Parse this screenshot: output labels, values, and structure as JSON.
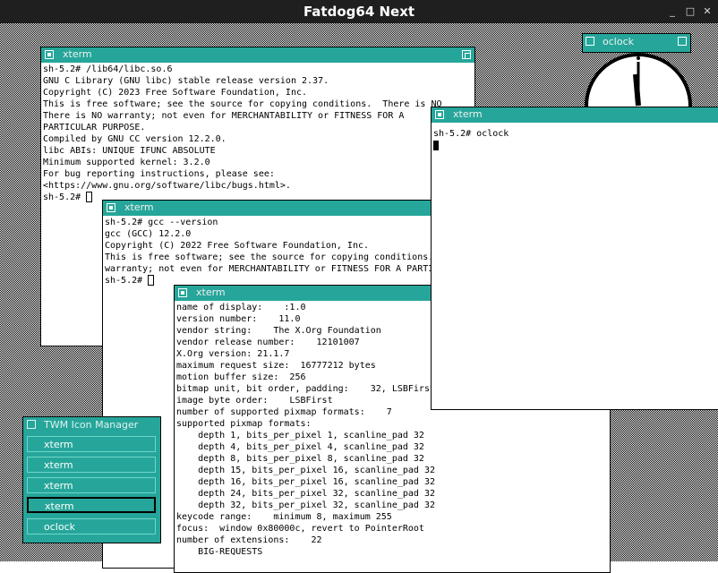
{
  "screen": {
    "title": "Fatdog64 Next",
    "btn_min": "_",
    "btn_max": "□",
    "btn_close": "✕"
  },
  "win1": {
    "title": "xterm",
    "lines": [
      "sh-5.2# /lib64/libc.so.6",
      "GNU C Library (GNU libc) stable release version 2.37.",
      "Copyright (C) 2023 Free Software Foundation, Inc.",
      "This is free software; see the source for copying conditions.  There is NO",
      "There is NO warranty; not even for MERCHANTABILITY or FITNESS FOR A",
      "PARTICULAR PURPOSE.",
      "Compiled by GNU CC version 12.2.0.",
      "libc ABIs: UNIQUE IFUNC ABSOLUTE",
      "Minimum supported kernel: 3.2.0",
      "For bug reporting instructions, please see:",
      "<https://www.gnu.org/software/libc/bugs.html>.",
      "sh-5.2# "
    ]
  },
  "win2": {
    "title": "xterm",
    "lines": [
      "sh-5.2# gcc --version",
      "gcc (GCC) 12.2.0",
      "Copyright (C) 2022 Free Software Foundation, Inc.",
      "This is free software; see the source for copying conditions.",
      "warranty; not even for MERCHANTABILITY or FITNESS FOR A PARTI",
      "",
      "sh-5.2# "
    ]
  },
  "win3": {
    "title": "xterm",
    "lines": [
      "name of display:    :1.0",
      "version number:    11.0",
      "vendor string:    The X.Org Foundation",
      "vendor release number:    12101007",
      "X.Org version: 21.1.7",
      "maximum request size:  16777212 bytes",
      "motion buffer size:  256",
      "bitmap unit, bit order, padding:    32, LSBFirst",
      "image byte order:    LSBFirst",
      "number of supported pixmap formats:    7",
      "supported pixmap formats:",
      "    depth 1, bits_per_pixel 1, scanline_pad 32",
      "    depth 4, bits_per_pixel 4, scanline_pad 32",
      "    depth 8, bits_per_pixel 8, scanline_pad 32",
      "    depth 15, bits_per_pixel 16, scanline_pad 32",
      "    depth 16, bits_per_pixel 16, scanline_pad 32",
      "    depth 24, bits_per_pixel 32, scanline_pad 32",
      "    depth 32, bits_per_pixel 32, scanline_pad 32",
      "keycode range:    minimum 8, maximum 255",
      "focus:  window 0x80000c, revert to PointerRoot",
      "number of extensions:    22",
      "    BIG-REQUESTS"
    ]
  },
  "win4": {
    "title": "xterm",
    "lines": [
      "sh-5.2# oclock"
    ]
  },
  "oclock": {
    "title": "oclock"
  },
  "iconmgr": {
    "title": "TWM Icon Manager",
    "items": [
      "xterm",
      "xterm",
      "xterm",
      "xterm",
      "oclock"
    ]
  },
  "colors": {
    "titlebar": "#26a69a",
    "outer_title": "#1f1f1f"
  }
}
